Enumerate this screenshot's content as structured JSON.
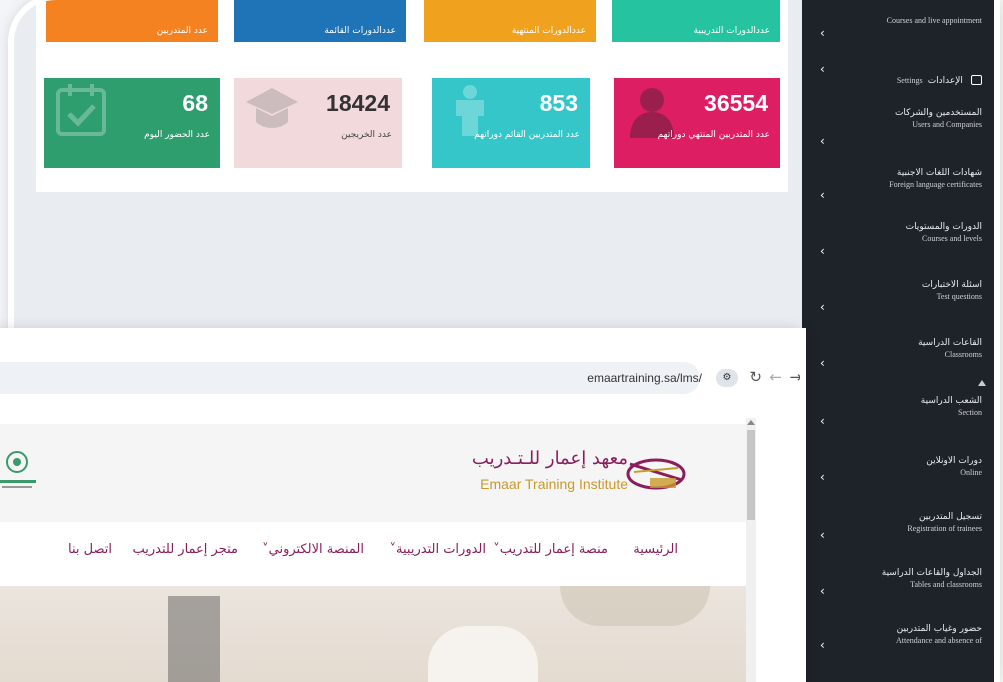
{
  "dashboard": {
    "top_row": [
      {
        "label": "عدد المتدربين",
        "color": "#f58220"
      },
      {
        "label": "عددالدورات القائمة",
        "color": "#1f73b7"
      },
      {
        "label": "عددالدورات المنتهية",
        "color": "#f0a21f"
      },
      {
        "label": "عددالدورات التدريبية",
        "color": "#26c3a0"
      }
    ],
    "stats": [
      {
        "value": "68",
        "label": "عدد الحضور اليوم",
        "color": "#2f9e6f",
        "icon": "calendar-check-icon"
      },
      {
        "value": "18424",
        "label": "عدد الخريجين",
        "color": "#f2d9dc",
        "icon": "graduation-cap-icon"
      },
      {
        "value": "853",
        "label": "عدد المتدربين القائم دوراتهم",
        "color": "#35c6c9",
        "icon": "person-icon"
      },
      {
        "value": "36554",
        "label": "عدد المتدربين المنتهي دوراتهم",
        "color": "#de1e63",
        "icon": "user-silhouette-icon"
      }
    ]
  },
  "sidebar": {
    "items": [
      {
        "ar": "",
        "en": "Courses and live appointment",
        "icon": "calendar-icon"
      },
      {
        "ar": "الإعدادات",
        "en": "Settings",
        "icon": "users-icon"
      },
      {
        "ar": "المستخدمين والشركات",
        "en": "Users and Companies",
        "icon": "users-icon"
      },
      {
        "ar": "شهادات اللغات الاجنبية",
        "en": "Foreign language certificates",
        "icon": "badge-icon"
      },
      {
        "ar": "الدورات والمستويات",
        "en": "Courses and levels",
        "icon": "calendar-icon"
      },
      {
        "ar": "اسئلة الاختبارات",
        "en": "Test questions",
        "icon": "calendar-icon"
      },
      {
        "ar": "القاعات الدراسية",
        "en": "Classrooms",
        "icon": "server-icon"
      },
      {
        "ar": "الشعب الدراسية",
        "en": "Section",
        "icon": "bar-chart-icon"
      },
      {
        "ar": "دورات الاونلاين",
        "en": "Online",
        "icon": "bar-chart-icon"
      },
      {
        "ar": "تسجيل المتدربين",
        "en": "Registration of trainees",
        "icon": "calendar-grid-icon"
      },
      {
        "ar": "الجداول والقاعات الدراسية",
        "en": "Tables and classrooms",
        "icon": "monitor-icon"
      },
      {
        "ar": "حضور وغياب المتدربين",
        "en": "Attendance and absence of",
        "icon": "person-icon"
      }
    ]
  },
  "browser": {
    "url": "emaartraining.sa/lms/",
    "tune_icon": "⚙",
    "reload_icon": "↻",
    "back_icon": "←",
    "forward_icon": "→"
  },
  "site": {
    "logo_ar": "معهد إعمار للـتـدريب",
    "logo_en": "Emaar Training Institute",
    "menu": [
      {
        "label": "الرئيسية"
      },
      {
        "label": "منصة إعمار للتدريب˅"
      },
      {
        "label": "الدورات التدريبية˅"
      },
      {
        "label": "المنصة الالكتروني˅"
      },
      {
        "label": "متجر إعمار للتدريب"
      },
      {
        "label": "اتصل بنا"
      }
    ]
  },
  "colors": {
    "sidebar_bg": "#1e2229",
    "brand_purple": "#8a1e5c",
    "brand_gold": "#c89a2b"
  }
}
